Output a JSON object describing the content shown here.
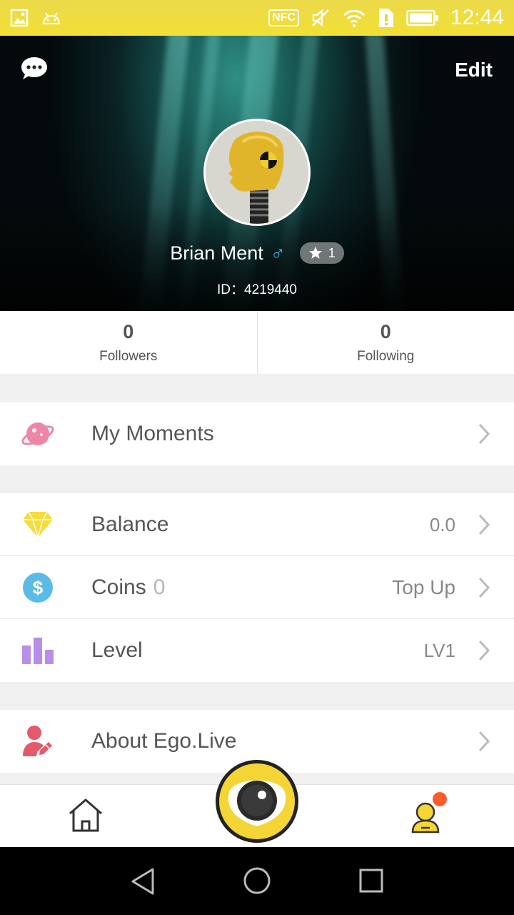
{
  "status_bar": {
    "time": "12:44",
    "nfc_label": "NFC",
    "icons": [
      "image-icon",
      "android-icon",
      "nfc-icon",
      "mute-icon",
      "wifi-icon",
      "sim-alert-icon",
      "battery-icon"
    ]
  },
  "header": {
    "edit_label": "Edit",
    "username": "Brian Ment",
    "gender_symbol": "♂",
    "level_badge": "1",
    "user_id": "ID：4219440"
  },
  "stats": {
    "followers": {
      "count": "0",
      "label": "Followers"
    },
    "following": {
      "count": "0",
      "label": "Following"
    }
  },
  "menu": {
    "moments": {
      "label": "My Moments",
      "icon": "planet-icon"
    },
    "balance": {
      "label": "Balance",
      "value": "0.0",
      "icon": "diamond-icon"
    },
    "coins": {
      "label": "Coins",
      "count": "0",
      "value": "Top Up",
      "icon": "dollar-coin-icon"
    },
    "level": {
      "label": "Level",
      "value": "LV1",
      "icon": "bar-chart-icon"
    },
    "about": {
      "label": "About Ego.Live",
      "icon": "user-edit-icon"
    }
  },
  "colors": {
    "status_bar": "#f2e035",
    "brand_yellow": "#f4d535",
    "moments_icon": "#ef86a8",
    "balance_icon": "#f6dc3a",
    "coins_icon": "#5bbbe8",
    "level_icon": "#b98ee8",
    "about_icon": "#e4596b",
    "notification_dot": "#ff5a2c",
    "gender": "#3ab4f2"
  }
}
